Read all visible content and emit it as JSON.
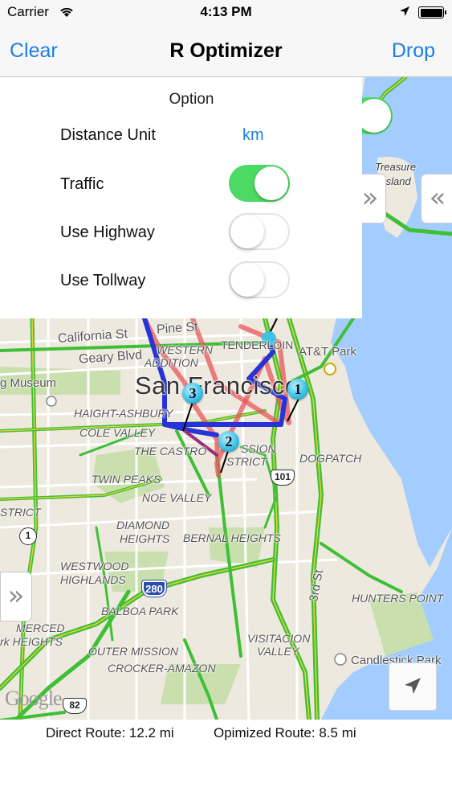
{
  "status_bar": {
    "carrier": "Carrier",
    "time": "4:13 PM",
    "wifi_icon": "wifi-icon",
    "location_icon": "location-arrow-icon",
    "battery_icon": "battery-full-icon"
  },
  "nav": {
    "title": "R Optimizer",
    "left_button": "Clear",
    "right_button": "Drop",
    "accent_color": "#1a7ee6"
  },
  "options": {
    "heading": "Option",
    "distance_unit_label": "Distance Unit",
    "distance_unit_value": "km",
    "traffic_label": "Traffic",
    "traffic_on": true,
    "highway_label": "Use Highway",
    "highway_on": false,
    "tollway_label": "Use Tollway",
    "tollway_on": false,
    "toggle_on_color": "#4cd964"
  },
  "map": {
    "labels": {
      "california_st": "California St",
      "pine_st": "Pine St",
      "geary_blvd": "Geary Blvd",
      "western_addition_1": "WESTERN",
      "western_addition_2": "ADDITION",
      "tenderloin": "TENDERLOIN",
      "att_park": "AT&T Park",
      "museum": "g Museum",
      "san_francisco": "San Francisco",
      "haight_ashbury": "HAIGHT-ASHBURY",
      "cole_valley": "COLE VALLEY",
      "the_castro": "THE CASTRO",
      "mission_1": "SSION",
      "mission_2": "STRICT",
      "dogpatch": "DOGPATCH",
      "twin_peaks": "TWIN PEAKS",
      "noe_valley": "NOE VALLEY",
      "strict_left": "STRICT",
      "diamond_heights_1": "DIAMOND",
      "diamond_heights_2": "HEIGHTS",
      "bernal_heights": "BERNAL HEIGHTS",
      "westwood_highlands_1": "WESTWOOD",
      "westwood_highlands_2": "HIGHLANDS",
      "balboa_park": "BALBOA PARK",
      "hunters_point": "HUNTERS POINT",
      "merced_heights_1": "MERCED",
      "merced_heights_2": "rk HEIGHTS",
      "outer_mission": "OUTER MISSION",
      "crocker_amazon": "CROCKER-AMAZON",
      "visitacion_valley_1": "VISITACION",
      "visitacion_valley_2": "VALLEY",
      "third_st": "3rd St",
      "candlestick_park": "Candlestick Park",
      "treasure_island_1": "Treasure",
      "treasure_island_2": "Island",
      "google": "Google"
    },
    "shields": {
      "us101": "101",
      "i280": "280",
      "ca1": "1",
      "ca82": "82"
    },
    "markers": [
      "1",
      "2",
      "3"
    ],
    "handle_glyph": "»",
    "handle_glyph_back": "«",
    "route_colors": {
      "direct": "#e8565a",
      "optimized": "#2733d6",
      "traffic_free": "#3fbf35",
      "traffic_slow": "#e8d23a"
    }
  },
  "footer": {
    "direct_route": "Direct Route: 12.2 mi",
    "optimized_route": "Opimized Route: 8.5 mi"
  }
}
